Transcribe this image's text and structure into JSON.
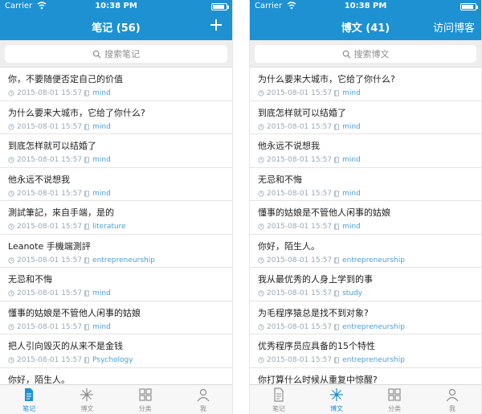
{
  "left": {
    "status": {
      "carrier": "Carrier",
      "time": "10:38 PM"
    },
    "nav": {
      "title": "笔记 (56)"
    },
    "search": {
      "placeholder": "搜索笔记"
    },
    "items": [
      {
        "title": "你，不要随便否定自己的价值",
        "date": "2015-08-01 15:57",
        "notebook": "mind"
      },
      {
        "title": "为什么要来大城市，它给了你什么?",
        "date": "2015-08-01 15:57",
        "notebook": "mind"
      },
      {
        "title": "到底怎样就可以结婚了",
        "date": "2015-08-01 15:57",
        "notebook": "mind"
      },
      {
        "title": "他永远不说想我",
        "date": "2015-08-01 15:57",
        "notebook": "mind"
      },
      {
        "title": "測試筆記，來自手端，是的",
        "date": "2015-08-01 15:57",
        "notebook": "literature"
      },
      {
        "title": "Leanote 手機端測評",
        "date": "2015-08-01 15:57",
        "notebook": "entrepreneurship"
      },
      {
        "title": "无忌和不悔",
        "date": "2015-08-01 15:57",
        "notebook": "mind"
      },
      {
        "title": "懂事的姑娘是不管他人闲事的姑娘",
        "date": "2015-08-01 15:57",
        "notebook": "mind"
      },
      {
        "title": "把人引向毁灭的从来不是金钱",
        "date": "2015-08-01 15:57",
        "notebook": "Psychology"
      },
      {
        "title": "你好，陌生人。",
        "date": "",
        "notebook": ""
      }
    ],
    "tabs": [
      "笔记",
      "博文",
      "分类",
      "我"
    ]
  },
  "right": {
    "status": {
      "carrier": "Carrier",
      "time": "10:38 PM"
    },
    "nav": {
      "title": "博文 (41)",
      "right_label": "访问博客"
    },
    "search": {
      "placeholder": "搜索博文"
    },
    "items": [
      {
        "title": "为什么要来大城市，它给了你什么?",
        "date": "2015-08-01 15:57",
        "notebook": "mind"
      },
      {
        "title": "到底怎样就可以结婚了",
        "date": "2015-08-01 15:57",
        "notebook": "mind"
      },
      {
        "title": "他永远不说想我",
        "date": "2015-08-01 15:57",
        "notebook": "mind"
      },
      {
        "title": "无忌和不悔",
        "date": "2015-08-01 15:57",
        "notebook": "mind"
      },
      {
        "title": "懂事的姑娘是不管他人闲事的姑娘",
        "date": "2015-08-01 15:57",
        "notebook": "mind"
      },
      {
        "title": "你好，陌生人。",
        "date": "2015-08-01 15:57",
        "notebook": "entrepreneurship"
      },
      {
        "title": "我从最优秀的人身上学到的事",
        "date": "2015-08-01 15:57",
        "notebook": "study"
      },
      {
        "title": "为毛程序猿总是找不到对象?",
        "date": "2015-08-01 15:57",
        "notebook": "entrepreneurship"
      },
      {
        "title": "优秀程序员应具备的15个特性",
        "date": "2015-08-01 15:57",
        "notebook": "entrepreneurship"
      },
      {
        "title": "你打算什么时候从重复中惊醒?",
        "date": "",
        "notebook": ""
      }
    ],
    "tabs": [
      "笔记",
      "博文",
      "分类",
      "我"
    ]
  },
  "colors": {
    "accent": "#1e91d3",
    "meta": "#9aa8b4",
    "notebook": "#4a9fd4"
  },
  "battery_level": 0.85
}
